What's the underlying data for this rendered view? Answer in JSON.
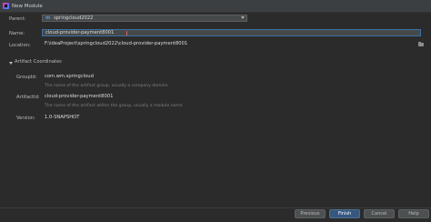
{
  "window": {
    "title": "New Module"
  },
  "form": {
    "parent_label": "Parent:",
    "parent_value": "springcloud2022",
    "parent_icon": "m",
    "name_label": "Name:",
    "name_value": "cloud-provider-payment8001",
    "location_label": "Location:",
    "location_value": "F:\\ideaProject\\springcloud2022\\cloud-provider-payment8001"
  },
  "artifact": {
    "section_title": "Artifact Coordinates",
    "groupid_label": "GroupId:",
    "groupid_value": "com.wm.springcloud",
    "groupid_hint": "The name of the artifact group, usually a company domain",
    "artifactid_label": "ArtifactId:",
    "artifactid_value": "cloud-provider-payment8001",
    "artifactid_hint": "The name of the artifact within the group, usually a module name",
    "version_label": "Version:",
    "version_value": "1.0-SNAPSHOT"
  },
  "buttons": {
    "previous": "Previous",
    "finish": "Finish",
    "cancel": "Cancel",
    "help": "Help"
  }
}
